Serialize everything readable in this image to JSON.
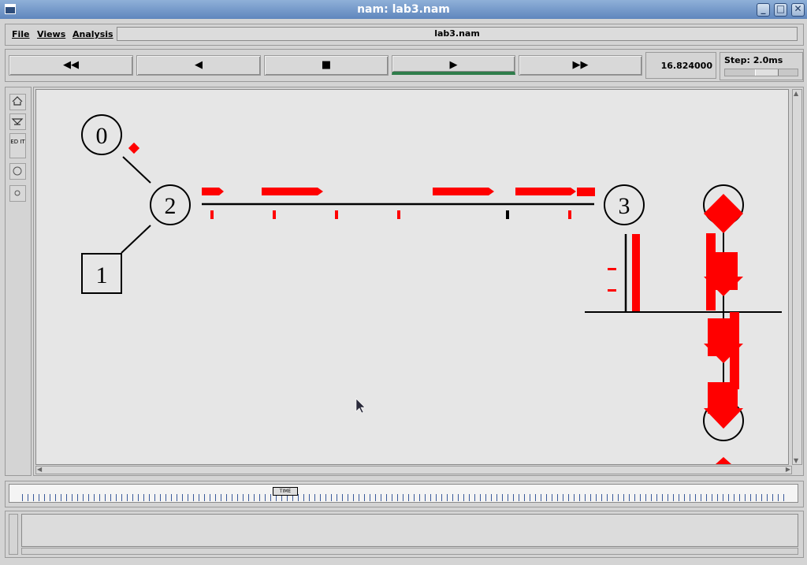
{
  "window": {
    "title": "nam: lab3.nam"
  },
  "menu": {
    "file": "File",
    "views": "Views",
    "analysis": "Analysis",
    "filename": "lab3.nam"
  },
  "toolbar": {
    "rewind_icon": "rewind-icon",
    "back_icon": "step-back-icon",
    "stop_icon": "stop-icon",
    "play_icon": "play-icon",
    "fastforward_icon": "fast-forward-icon",
    "sim_time": "16.824000",
    "step_label": "Step: 2.0ms"
  },
  "side_tools": {
    "edit_label": "ED IT"
  },
  "network": {
    "nodes": [
      {
        "id": "0",
        "shape": "circle"
      },
      {
        "id": "1",
        "shape": "square"
      },
      {
        "id": "2",
        "shape": "circle"
      },
      {
        "id": "3",
        "shape": "circle"
      },
      {
        "id": "",
        "shape": "circle"
      },
      {
        "id": "",
        "shape": "circle"
      }
    ],
    "packet_color": "#ff0000"
  },
  "timeline": {
    "marker_label": "TIME"
  }
}
